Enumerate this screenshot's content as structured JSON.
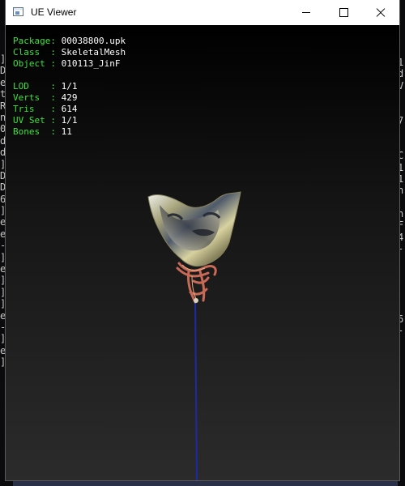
{
  "window": {
    "title": "UE Viewer",
    "icons": {
      "app": "window-app-icon",
      "minimize": "minimize-icon",
      "maximize": "maximize-icon",
      "close": "close-icon"
    }
  },
  "info": {
    "package": {
      "label": "Package: ",
      "value": "00038800.upk"
    },
    "class": {
      "label": "Class  : ",
      "value": "SkeletalMesh"
    },
    "object": {
      "label": "Object : ",
      "value": "010113_JinF"
    },
    "lod": {
      "label": "LOD    : ",
      "value": "1/1"
    },
    "verts": {
      "label": "Verts  : ",
      "value": "429"
    },
    "tris": {
      "label": "Tris   : ",
      "value": "614"
    },
    "uvset": {
      "label": "UV Set : ",
      "value": "1/1"
    },
    "bones": {
      "label": "Bones  : ",
      "value": "11"
    },
    "colors": {
      "label": "#3ee03e",
      "value": "#ffffff"
    }
  },
  "background_console": {
    "left": [
      "]",
      "D",
      "e",
      "t",
      "R",
      "n",
      "0",
      "d",
      "d",
      "]",
      "D",
      "D",
      "6",
      "]",
      "e",
      "e",
      "-",
      "]",
      "e",
      "]",
      "]",
      "]",
      "e",
      "-",
      "]",
      "e",
      "]"
    ],
    "right": [
      "1",
      "d",
      "V",
      "",
      "",
      "7",
      "",
      "",
      "C",
      "1",
      "1",
      "n",
      "",
      "n",
      "F",
      "4",
      "-",
      "",
      "",
      "",
      "",
      "",
      "6",
      "-"
    ]
  }
}
